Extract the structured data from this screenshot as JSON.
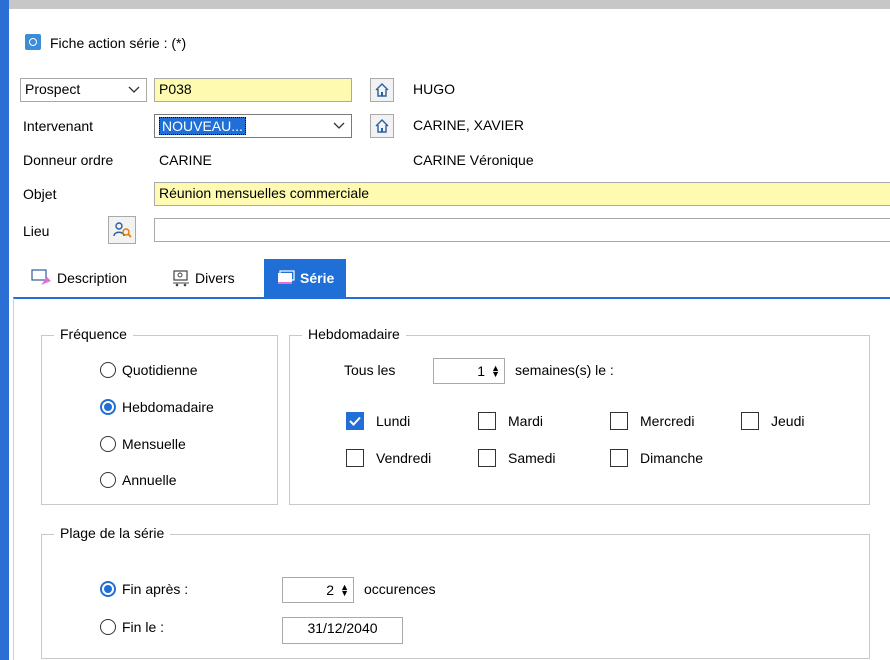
{
  "window": {
    "title": "Fiche action série : (*)"
  },
  "form": {
    "type_select": "Prospect",
    "code": "P038",
    "name": "HUGO",
    "intervenant_label": "Intervenant",
    "intervenant_select": "NOUVEAU...",
    "intervenant_name": "CARINE, XAVIER",
    "donneur_label": "Donneur ordre",
    "donneur_value": "CARINE",
    "donneur_fullname": "CARINE Véronique",
    "objet_label": "Objet",
    "objet_value": "Réunion mensuelles commerciale",
    "lieu_label": "Lieu",
    "lieu_value": ""
  },
  "tabs": [
    {
      "label": "Description",
      "icon": "pin-icon"
    },
    {
      "label": "Divers",
      "icon": "cart-icon"
    },
    {
      "label": "Série",
      "icon": "calendar-icon",
      "active": true
    }
  ],
  "frequence": {
    "title": "Fréquence",
    "options": [
      "Quotidienne",
      "Hebdomadaire",
      "Mensuelle",
      "Annuelle"
    ],
    "selected": "Hebdomadaire"
  },
  "hebdo": {
    "title": "Hebdomadaire",
    "tous_les": "Tous les",
    "interval": "1",
    "suffix": "semaines(s) le :",
    "days": [
      {
        "label": "Lundi",
        "checked": true
      },
      {
        "label": "Mardi",
        "checked": false
      },
      {
        "label": "Mercredi",
        "checked": false
      },
      {
        "label": "Jeudi",
        "checked": false
      },
      {
        "label": "Vendredi",
        "checked": false
      },
      {
        "label": "Samedi",
        "checked": false
      },
      {
        "label": "Dimanche",
        "checked": false
      }
    ]
  },
  "plage": {
    "title": "Plage de la série",
    "fin_apres_label": "Fin après :",
    "occurrences": "2",
    "occurrences_label": "occurences",
    "fin_le_label": "Fin le :",
    "fin_le_date": "31/12/2040",
    "selected": "Fin après"
  },
  "colors": {
    "accent": "#1f6fd6",
    "highlight": "#fefbb1"
  }
}
